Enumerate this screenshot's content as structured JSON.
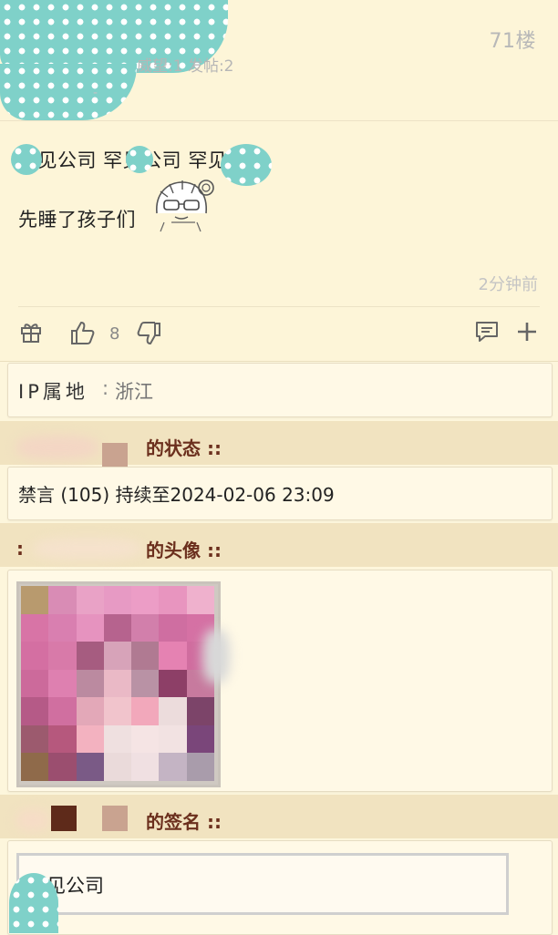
{
  "post": {
    "floor": "71楼",
    "meta": "威望:1 发帖:2",
    "meta_partial": "-",
    "lines": [
      "罕见公司 罕见公司 罕见公司",
      "先睡了孩子们"
    ],
    "time": "2分钟前",
    "like_count": "8"
  },
  "profile": {
    "ip_label": "IP属地",
    "ip_colon": ":",
    "ip_value": "浙江",
    "status_title": "的状态 ::",
    "status_value": "禁言 (105) 持续至2024-02-06 23:09",
    "avatar_title": "的头像 ::",
    "signature_title": "的签名 ::",
    "signature_value": "罕见公司"
  },
  "icons": {
    "gift": "gift-icon",
    "like": "thumbs-up-icon",
    "dislike": "thumbs-down-icon",
    "comment": "comment-icon",
    "add": "plus-icon"
  },
  "colors": {
    "background": "#fdf6dc",
    "section_title": "#6b2f1d",
    "redaction": "#7fd1c9"
  }
}
